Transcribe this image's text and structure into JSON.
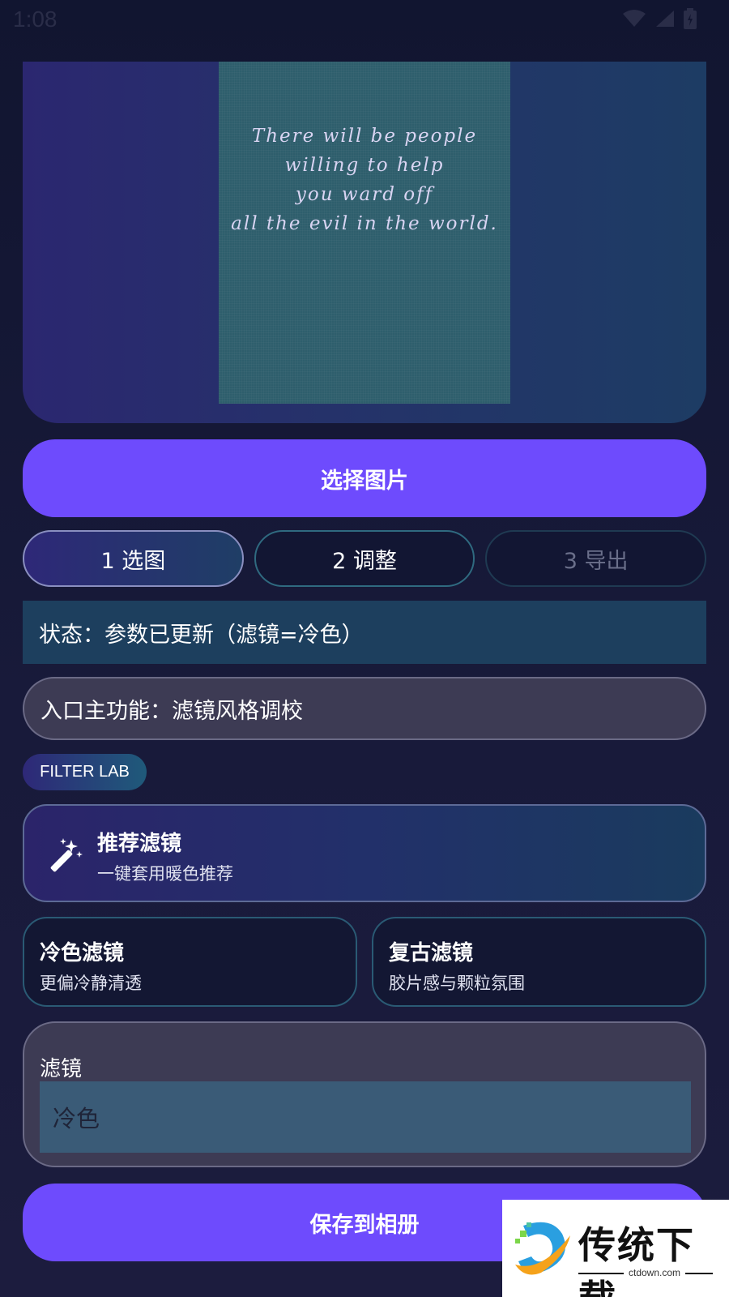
{
  "status_bar": {
    "time": "1:08"
  },
  "preview": {
    "photo_lines": [
      "There will be people",
      "willing to help",
      "you ward off",
      "all the evil in the world."
    ]
  },
  "actions": {
    "pick_image": "选择图片",
    "save_to_album": "保存到相册"
  },
  "steps": [
    {
      "label": "1 选图",
      "state": "active"
    },
    {
      "label": "2 调整",
      "state": "enabled"
    },
    {
      "label": "3 导出",
      "state": "disabled"
    }
  ],
  "status_text": "状态：参数已更新（滤镜=冷色）",
  "entry_text": "入口主功能：滤镜风格调校",
  "tag": "FILTER LAB",
  "cards": {
    "recommend": {
      "title": "推荐滤镜",
      "subtitle": "一键套用暖色推荐",
      "icon": "magic-wand-icon"
    },
    "cold": {
      "title": "冷色滤镜",
      "subtitle": "更偏冷静清透"
    },
    "vintage": {
      "title": "复古滤镜",
      "subtitle": "胶片感与颗粒氛围"
    }
  },
  "filter_field": {
    "label": "滤镜",
    "value": "冷色"
  },
  "watermark": {
    "title": "传统下载",
    "subtitle": "ctdown.com"
  },
  "colors": {
    "accent": "#6e4bfd",
    "background": "#141733",
    "status_strip": "#1d3f5e",
    "field": "#3d3b54"
  }
}
